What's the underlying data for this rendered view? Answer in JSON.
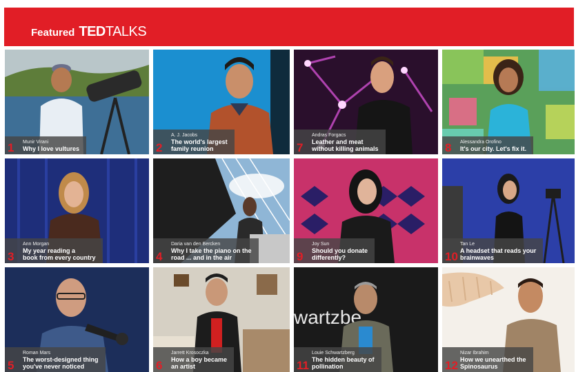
{
  "banner": {
    "featured": "Featured",
    "ted": "TED",
    "talks": "TALKS",
    "color": "#e11e26"
  },
  "talks": [
    {
      "number": "1",
      "speaker": "Munir Virani",
      "title": "Why I love vultures"
    },
    {
      "number": "2",
      "speaker": "A. J. Jacobs",
      "title": "The world's largest\nfamily reunion"
    },
    {
      "number": "7",
      "speaker": "Andras Forgacs",
      "title": "Leather and meat\nwithout killing animals"
    },
    {
      "number": "8",
      "speaker": "Alessandra Orofino",
      "title": "It's our city. Let's fix it."
    },
    {
      "number": "3",
      "speaker": "Ann Morgan",
      "title": "My year reading a\nbook from every country"
    },
    {
      "number": "4",
      "speaker": "Daria van den Bercken",
      "title": "Why I take the piano on the\nroad ... and in the air"
    },
    {
      "number": "9",
      "speaker": "Joy Sun",
      "title": "Should you donate\ndifferently?"
    },
    {
      "number": "10",
      "speaker": "Tan Le",
      "title": "A headset that reads your\nbrainwaves"
    },
    {
      "number": "5",
      "speaker": "Roman Mars",
      "title": "The worst-designed thing\nyou've never noticed"
    },
    {
      "number": "6",
      "speaker": "Jarrett Krosoczka",
      "title": "How a boy became\nan artist"
    },
    {
      "number": "11",
      "speaker": "Louie Schwartzberg",
      "title": "The hidden beauty of\npollination"
    },
    {
      "number": "12",
      "speaker": "Nizar Ibrahim",
      "title": "How we unearthed the\nSpinosaurus"
    }
  ],
  "backdrop_text": "wartzbe"
}
